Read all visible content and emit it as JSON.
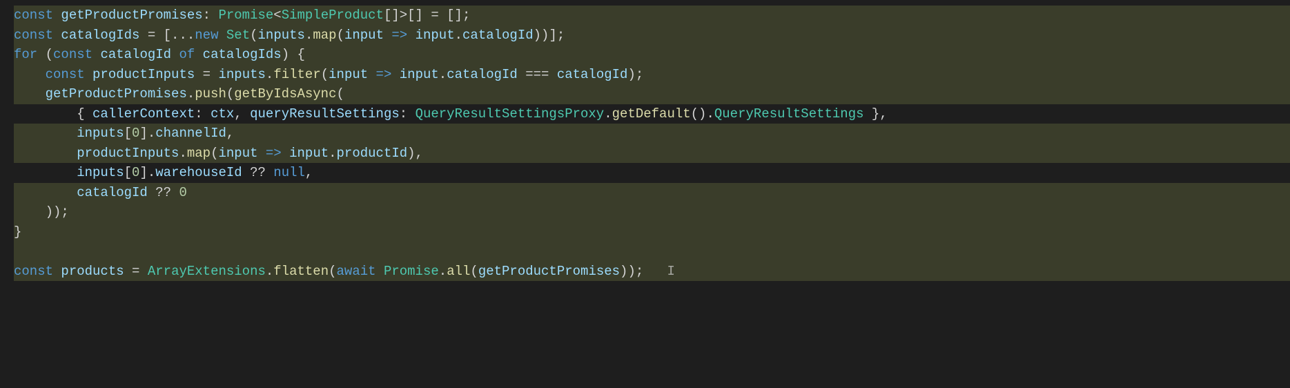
{
  "code": {
    "lines": [
      {
        "highlighted": true,
        "tokens": [
          {
            "text": "const ",
            "class": "kw"
          },
          {
            "text": "getProductPromises",
            "class": "var"
          },
          {
            "text": ": ",
            "class": "punct"
          },
          {
            "text": "Promise",
            "class": "type"
          },
          {
            "text": "<",
            "class": "punct"
          },
          {
            "text": "SimpleProduct",
            "class": "type"
          },
          {
            "text": "[]>[] = [];",
            "class": "punct"
          }
        ]
      },
      {
        "highlighted": true,
        "tokens": [
          {
            "text": "const ",
            "class": "kw"
          },
          {
            "text": "catalogIds",
            "class": "var"
          },
          {
            "text": " = [...",
            "class": "punct"
          },
          {
            "text": "new ",
            "class": "kw"
          },
          {
            "text": "Set",
            "class": "type"
          },
          {
            "text": "(",
            "class": "punct"
          },
          {
            "text": "inputs",
            "class": "var"
          },
          {
            "text": ".",
            "class": "punct"
          },
          {
            "text": "map",
            "class": "method"
          },
          {
            "text": "(",
            "class": "punct"
          },
          {
            "text": "input",
            "class": "var"
          },
          {
            "text": " => ",
            "class": "kw"
          },
          {
            "text": "input",
            "class": "var"
          },
          {
            "text": ".",
            "class": "punct"
          },
          {
            "text": "catalogId",
            "class": "prop"
          },
          {
            "text": "))];",
            "class": "punct"
          }
        ]
      },
      {
        "highlighted": true,
        "tokens": [
          {
            "text": "for ",
            "class": "kw"
          },
          {
            "text": "(",
            "class": "punct"
          },
          {
            "text": "const ",
            "class": "kw"
          },
          {
            "text": "catalogId",
            "class": "var"
          },
          {
            "text": " of ",
            "class": "kw"
          },
          {
            "text": "catalogIds",
            "class": "var"
          },
          {
            "text": ") {",
            "class": "punct"
          }
        ]
      },
      {
        "highlighted": true,
        "indent": 1,
        "tokens": [
          {
            "text": "    ",
            "class": "punct"
          },
          {
            "text": "const ",
            "class": "kw"
          },
          {
            "text": "productInputs",
            "class": "var"
          },
          {
            "text": " = ",
            "class": "punct"
          },
          {
            "text": "inputs",
            "class": "var"
          },
          {
            "text": ".",
            "class": "punct"
          },
          {
            "text": "filter",
            "class": "method"
          },
          {
            "text": "(",
            "class": "punct"
          },
          {
            "text": "input",
            "class": "var"
          },
          {
            "text": " => ",
            "class": "kw"
          },
          {
            "text": "input",
            "class": "var"
          },
          {
            "text": ".",
            "class": "punct"
          },
          {
            "text": "catalogId",
            "class": "prop"
          },
          {
            "text": " === ",
            "class": "punct"
          },
          {
            "text": "catalogId",
            "class": "var"
          },
          {
            "text": ");",
            "class": "punct"
          }
        ]
      },
      {
        "highlighted": true,
        "indent": 1,
        "tokens": [
          {
            "text": "    ",
            "class": "punct"
          },
          {
            "text": "getProductPromises",
            "class": "var"
          },
          {
            "text": ".",
            "class": "punct"
          },
          {
            "text": "push",
            "class": "method"
          },
          {
            "text": "(",
            "class": "punct"
          },
          {
            "text": "getByIdsAsync",
            "class": "method"
          },
          {
            "text": "(",
            "class": "punct"
          }
        ]
      },
      {
        "highlighted": false,
        "indent": 2,
        "tokens": [
          {
            "text": "        { ",
            "class": "punct"
          },
          {
            "text": "callerContext",
            "class": "prop"
          },
          {
            "text": ": ",
            "class": "punct"
          },
          {
            "text": "ctx",
            "class": "var"
          },
          {
            "text": ", ",
            "class": "punct"
          },
          {
            "text": "queryResultSettings",
            "class": "prop"
          },
          {
            "text": ": ",
            "class": "punct"
          },
          {
            "text": "QueryResultSettingsProxy",
            "class": "type"
          },
          {
            "text": ".",
            "class": "punct"
          },
          {
            "text": "getDefault",
            "class": "method"
          },
          {
            "text": "().",
            "class": "punct"
          },
          {
            "text": "QueryResultSettings",
            "class": "type"
          },
          {
            "text": " },",
            "class": "punct"
          }
        ]
      },
      {
        "highlighted": true,
        "indent": 2,
        "tokens": [
          {
            "text": "        ",
            "class": "punct"
          },
          {
            "text": "inputs",
            "class": "var"
          },
          {
            "text": "[",
            "class": "punct"
          },
          {
            "text": "0",
            "class": "num"
          },
          {
            "text": "].",
            "class": "punct"
          },
          {
            "text": "channelId",
            "class": "prop"
          },
          {
            "text": ",",
            "class": "punct"
          }
        ]
      },
      {
        "highlighted": true,
        "indent": 2,
        "tokens": [
          {
            "text": "        ",
            "class": "punct"
          },
          {
            "text": "productInputs",
            "class": "var"
          },
          {
            "text": ".",
            "class": "punct"
          },
          {
            "text": "map",
            "class": "method"
          },
          {
            "text": "(",
            "class": "punct"
          },
          {
            "text": "input",
            "class": "var"
          },
          {
            "text": " => ",
            "class": "kw"
          },
          {
            "text": "input",
            "class": "var"
          },
          {
            "text": ".",
            "class": "punct"
          },
          {
            "text": "productId",
            "class": "prop"
          },
          {
            "text": "),",
            "class": "punct"
          }
        ]
      },
      {
        "highlighted": false,
        "indent": 2,
        "tokens": [
          {
            "text": "        ",
            "class": "punct"
          },
          {
            "text": "inputs",
            "class": "var"
          },
          {
            "text": "[",
            "class": "punct"
          },
          {
            "text": "0",
            "class": "num"
          },
          {
            "text": "].",
            "class": "punct"
          },
          {
            "text": "warehouseId",
            "class": "prop"
          },
          {
            "text": " ?? ",
            "class": "punct"
          },
          {
            "text": "null",
            "class": "kw"
          },
          {
            "text": ",",
            "class": "punct"
          }
        ]
      },
      {
        "highlighted": true,
        "indent": 2,
        "tokens": [
          {
            "text": "        ",
            "class": "punct"
          },
          {
            "text": "catalogId",
            "class": "var"
          },
          {
            "text": " ?? ",
            "class": "punct"
          },
          {
            "text": "0",
            "class": "num"
          }
        ]
      },
      {
        "highlighted": true,
        "indent": 1,
        "tokens": [
          {
            "text": "    ));",
            "class": "punct"
          }
        ]
      },
      {
        "highlighted": true,
        "tokens": [
          {
            "text": "}",
            "class": "punct"
          }
        ]
      },
      {
        "highlighted": true,
        "blank": true,
        "tokens": []
      },
      {
        "highlighted": true,
        "tokens": [
          {
            "text": "const ",
            "class": "kw"
          },
          {
            "text": "products",
            "class": "var"
          },
          {
            "text": " = ",
            "class": "punct"
          },
          {
            "text": "ArrayExtensions",
            "class": "type"
          },
          {
            "text": ".",
            "class": "punct"
          },
          {
            "text": "flatten",
            "class": "method"
          },
          {
            "text": "(",
            "class": "punct"
          },
          {
            "text": "await ",
            "class": "kw"
          },
          {
            "text": "Promise",
            "class": "type"
          },
          {
            "text": ".",
            "class": "punct"
          },
          {
            "text": "all",
            "class": "method"
          },
          {
            "text": "(",
            "class": "punct"
          },
          {
            "text": "getProductPromises",
            "class": "var"
          },
          {
            "text": "));",
            "class": "punct"
          }
        ],
        "cursor": true
      }
    ]
  }
}
